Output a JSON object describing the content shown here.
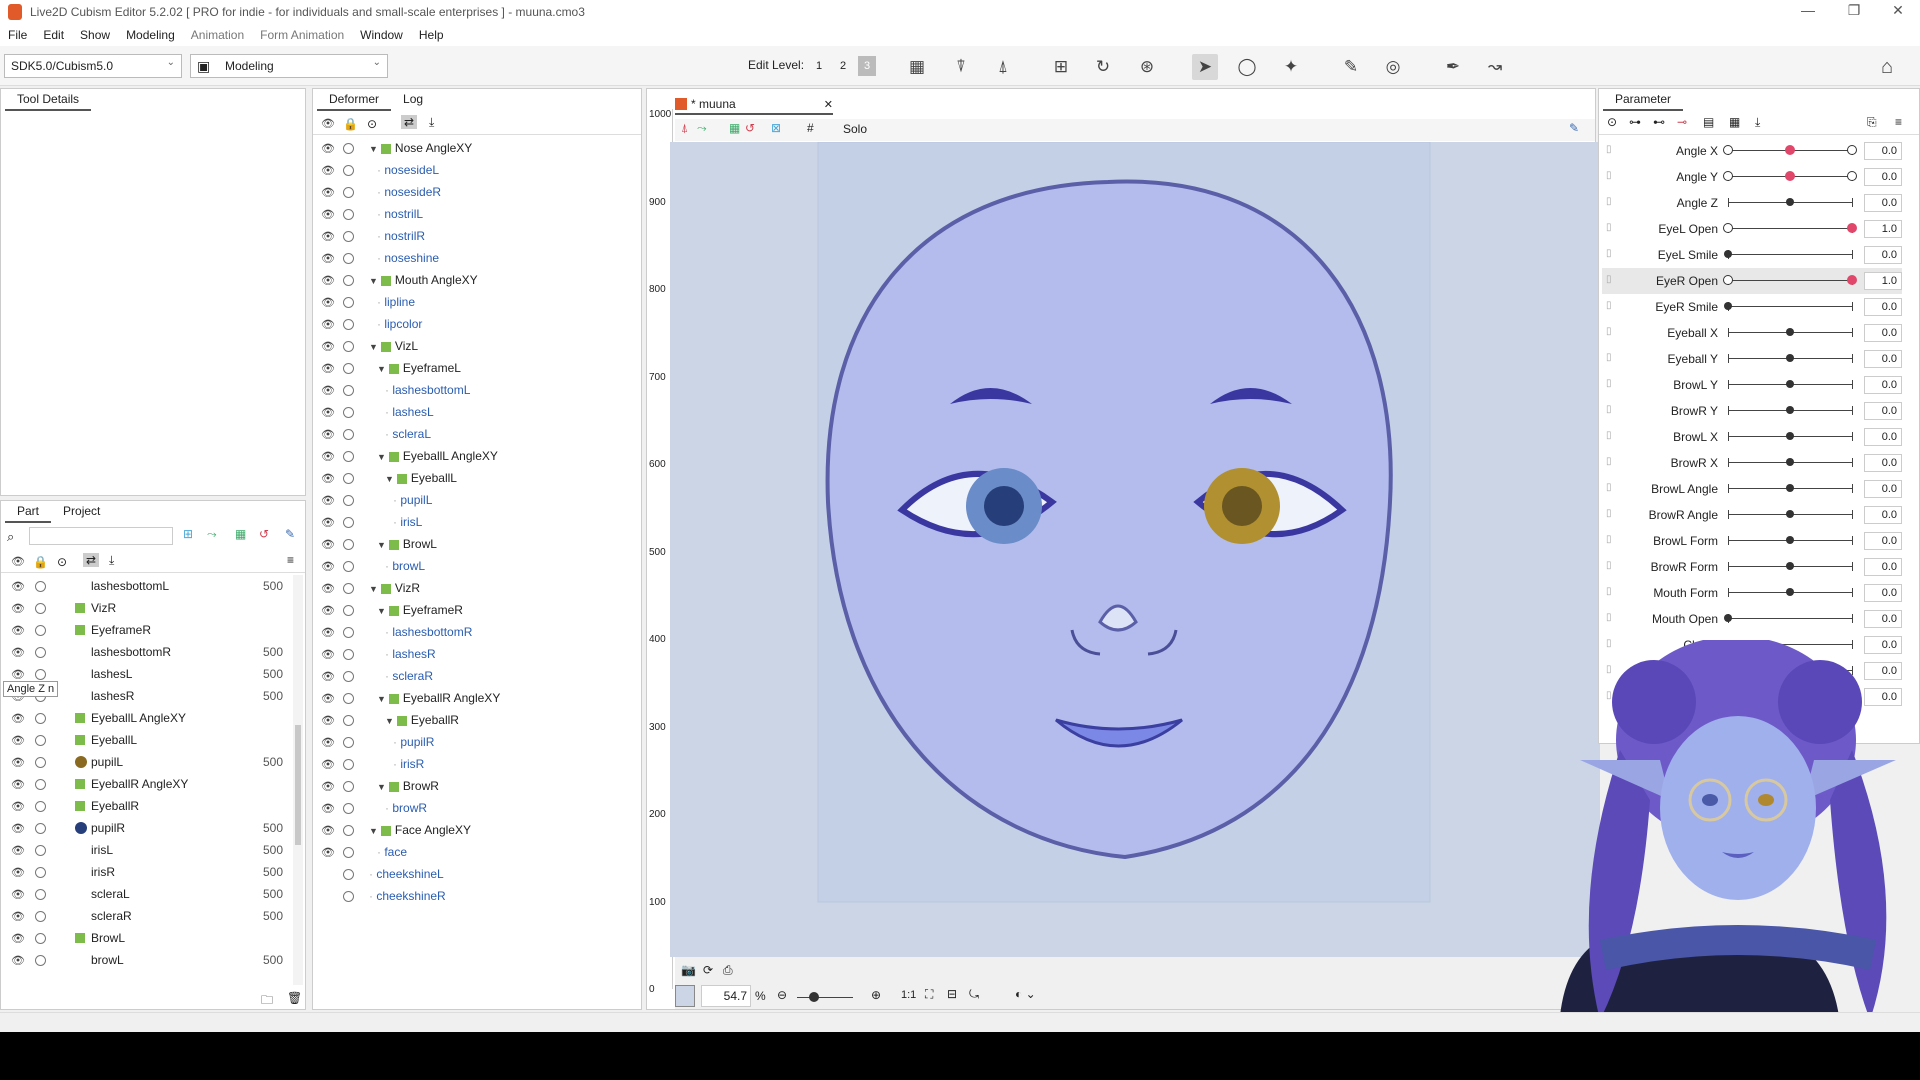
{
  "window": {
    "title": "Live2D Cubism Editor 5.2.02    [ PRO for indie - for individuals and small-scale enterprises ]  - muuna.cmo3"
  },
  "menu": [
    "File",
    "Edit",
    "Show",
    "Modeling",
    "Animation",
    "Form Animation",
    "Window",
    "Help"
  ],
  "toolbar": {
    "sdk": "SDK5.0/Cubism5.0",
    "mode": "Modeling",
    "edit_level_label": "Edit Level:",
    "levels": [
      "1",
      "2",
      "3"
    ]
  },
  "left_panel": {
    "tab": "Tool Details"
  },
  "deformer_panel": {
    "tabs": [
      "Deformer",
      "Log"
    ],
    "rows": [
      {
        "label": "Nose AngleXY",
        "type": "folder",
        "indent": 0
      },
      {
        "label": "nosesideL",
        "type": "mesh",
        "indent": 1
      },
      {
        "label": "nosesideR",
        "type": "mesh",
        "indent": 1
      },
      {
        "label": "nostrilL",
        "type": "mesh",
        "indent": 1
      },
      {
        "label": "nostrilR",
        "type": "mesh",
        "indent": 1
      },
      {
        "label": "noseshine",
        "type": "mesh",
        "indent": 1
      },
      {
        "label": "Mouth AngleXY",
        "type": "folder",
        "indent": 0
      },
      {
        "label": "lipline",
        "type": "mesh",
        "indent": 1
      },
      {
        "label": "lipcolor",
        "type": "mesh",
        "indent": 1
      },
      {
        "label": "VizL",
        "type": "folder",
        "indent": 0
      },
      {
        "label": "EyeframeL",
        "type": "folder",
        "indent": 1
      },
      {
        "label": "lashesbottomL",
        "type": "mesh",
        "indent": 2
      },
      {
        "label": "lashesL",
        "type": "mesh",
        "indent": 2
      },
      {
        "label": "scleraL",
        "type": "mesh",
        "indent": 2
      },
      {
        "label": "EyeballL AngleXY",
        "type": "folder",
        "indent": 1
      },
      {
        "label": "EyeballL",
        "type": "folder",
        "indent": 2
      },
      {
        "label": "pupilL",
        "type": "mesh",
        "indent": 3
      },
      {
        "label": "irisL",
        "type": "mesh",
        "indent": 3
      },
      {
        "label": "BrowL",
        "type": "folder",
        "indent": 1
      },
      {
        "label": "browL",
        "type": "mesh",
        "indent": 2
      },
      {
        "label": "VizR",
        "type": "folder",
        "indent": 0
      },
      {
        "label": "EyeframeR",
        "type": "folder",
        "indent": 1
      },
      {
        "label": "lashesbottomR",
        "type": "mesh",
        "indent": 2
      },
      {
        "label": "lashesR",
        "type": "mesh",
        "indent": 2
      },
      {
        "label": "scleraR",
        "type": "mesh",
        "indent": 2
      },
      {
        "label": "EyeballR AngleXY",
        "type": "folder",
        "indent": 1
      },
      {
        "label": "EyeballR",
        "type": "folder",
        "indent": 2
      },
      {
        "label": "pupilR",
        "type": "mesh",
        "indent": 3
      },
      {
        "label": "irisR",
        "type": "mesh",
        "indent": 3
      },
      {
        "label": "BrowR",
        "type": "folder",
        "indent": 1
      },
      {
        "label": "browR",
        "type": "mesh",
        "indent": 2
      },
      {
        "label": "Face AngleXY",
        "type": "folder",
        "indent": 0
      },
      {
        "label": "face",
        "type": "mesh",
        "indent": 1
      },
      {
        "label": "cheekshineL",
        "type": "mesh",
        "indent": 0
      },
      {
        "label": "cheekshineR",
        "type": "mesh",
        "indent": 0
      }
    ]
  },
  "part_panel": {
    "tabs": [
      "Part",
      "Project"
    ],
    "tooltip": "Angle Z",
    "rows": [
      {
        "label": "lashesbottomL",
        "num": "500",
        "kind": "mesh"
      },
      {
        "label": "VizR",
        "num": "",
        "kind": "folder"
      },
      {
        "label": "EyeframeR",
        "num": "",
        "kind": "folder"
      },
      {
        "label": "lashesbottomR",
        "num": "500",
        "kind": "mesh"
      },
      {
        "label": "lashesL",
        "num": "500",
        "kind": "mesh"
      },
      {
        "label": "lashesR",
        "num": "500",
        "kind": "mesh"
      },
      {
        "label": "EyeballL AngleXY",
        "num": "",
        "kind": "folder"
      },
      {
        "label": "EyeballL",
        "num": "",
        "kind": "folder"
      },
      {
        "label": "pupilL",
        "num": "500",
        "kind": "gold"
      },
      {
        "label": "EyeballR AngleXY",
        "num": "",
        "kind": "folder"
      },
      {
        "label": "EyeballR",
        "num": "",
        "kind": "folder"
      },
      {
        "label": "pupilR",
        "num": "500",
        "kind": "navy"
      },
      {
        "label": "irisL",
        "num": "500",
        "kind": "mesh"
      },
      {
        "label": "irisR",
        "num": "500",
        "kind": "mesh"
      },
      {
        "label": "scleraL",
        "num": "500",
        "kind": "mesh"
      },
      {
        "label": "scleraR",
        "num": "500",
        "kind": "mesh"
      },
      {
        "label": "BrowL",
        "num": "",
        "kind": "folder"
      },
      {
        "label": "browL",
        "num": "500",
        "kind": "mesh"
      }
    ]
  },
  "view": {
    "tab": "* muuna",
    "solo": "Solo",
    "ruler": [
      "1000",
      "900",
      "800",
      "700",
      "600",
      "500",
      "400",
      "300",
      "200",
      "100",
      "0"
    ],
    "zoom": "54.7",
    "zoom_unit": "%",
    "one_to_one": "1:1"
  },
  "parameter_panel": {
    "tab": "Parameter",
    "params": [
      {
        "name": "Angle X",
        "value": "0.0",
        "style": "three",
        "knob": 0.5
      },
      {
        "name": "Angle Y",
        "value": "0.0",
        "style": "three",
        "knob": 0.5
      },
      {
        "name": "Angle Z",
        "value": "0.0",
        "style": "tick",
        "knob": 0.5
      },
      {
        "name": "EyeL Open",
        "value": "1.0",
        "style": "open",
        "knob": 1.0
      },
      {
        "name": "EyeL Smile",
        "value": "0.0",
        "style": "tick",
        "knob": 0.0
      },
      {
        "name": "EyeR Open",
        "value": "1.0",
        "style": "open",
        "knob": 1.0,
        "highlight": true
      },
      {
        "name": "EyeR Smile",
        "value": "0.0",
        "style": "tick",
        "knob": 0.0
      },
      {
        "name": "Eyeball X",
        "value": "0.0",
        "style": "tick",
        "knob": 0.5
      },
      {
        "name": "Eyeball Y",
        "value": "0.0",
        "style": "tick",
        "knob": 0.5
      },
      {
        "name": "BrowL Y",
        "value": "0.0",
        "style": "tick",
        "knob": 0.5
      },
      {
        "name": "BrowR Y",
        "value": "0.0",
        "style": "tick",
        "knob": 0.5
      },
      {
        "name": "BrowL X",
        "value": "0.0",
        "style": "tick",
        "knob": 0.5
      },
      {
        "name": "BrowR X",
        "value": "0.0",
        "style": "tick",
        "knob": 0.5
      },
      {
        "name": "BrowL Angle",
        "value": "0.0",
        "style": "tick",
        "knob": 0.5
      },
      {
        "name": "BrowR Angle",
        "value": "0.0",
        "style": "tick",
        "knob": 0.5
      },
      {
        "name": "BrowL Form",
        "value": "0.0",
        "style": "tick",
        "knob": 0.5
      },
      {
        "name": "BrowR Form",
        "value": "0.0",
        "style": "tick",
        "knob": 0.5
      },
      {
        "name": "Mouth Form",
        "value": "0.0",
        "style": "tick",
        "knob": 0.5
      },
      {
        "name": "Mouth Open",
        "value": "0.0",
        "style": "tick",
        "knob": 0.0
      },
      {
        "name": "Cheek",
        "value": "0.0",
        "style": "tick",
        "knob": 0.0
      },
      {
        "name": "",
        "value": "0.0",
        "style": "tick",
        "knob": 0.0
      },
      {
        "name": "",
        "value": "0.0",
        "style": "tick",
        "knob": 0.0
      }
    ]
  },
  "colors": {
    "canvas_bg": "#cbd5e6",
    "face": "#b4bdeb",
    "accent_red": "#e0476b",
    "folder_green": "#7dbb4a",
    "link_blue": "#2a5db0"
  }
}
